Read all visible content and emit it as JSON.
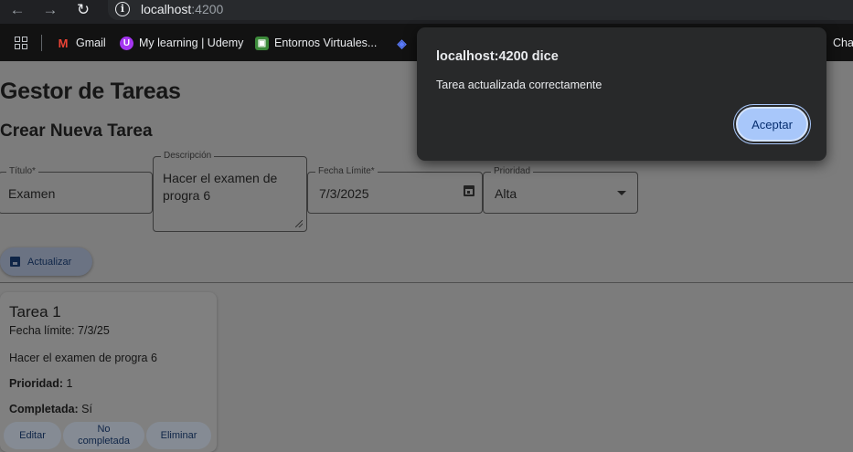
{
  "browser": {
    "url_host": "localhost",
    "url_port": ":4200",
    "bookmarks": [
      {
        "label": "Gmail",
        "icon": "gmail-icon"
      },
      {
        "label": "My learning | Udemy",
        "icon": "udemy-icon"
      },
      {
        "label": "Entornos Virtuales...",
        "icon": "course-icon"
      },
      {
        "label": "Cha",
        "icon": ""
      }
    ]
  },
  "page": {
    "title": "Gestor de Tareas",
    "form_title": "Crear Nueva Tarea",
    "fields": {
      "titulo": {
        "label": "Título*",
        "value": "Examen"
      },
      "descripcion": {
        "label": "Descripción",
        "value": "Hacer el examen de progra 6"
      },
      "fecha": {
        "label": "Fecha Límite*",
        "value": "7/3/2025"
      },
      "prioridad": {
        "label": "Prioridad",
        "value": "Alta"
      }
    },
    "update_button": "Actualizar"
  },
  "task_card": {
    "title": "Tarea 1",
    "fecha_limite": "Fecha límite: 7/3/25",
    "descripcion": "Hacer el examen de progra 6",
    "prioridad_label": "Prioridad:",
    "prioridad_value": " 1",
    "completada_label": "Completada:",
    "completada_value": " Sí",
    "buttons": {
      "edit": "Editar",
      "toggle": "No completada",
      "delete": "Eliminar"
    }
  },
  "dialog": {
    "title": "localhost:4200 dice",
    "message": "Tarea actualizada correctamente",
    "accept": "Aceptar",
    "accent": "#a8c7fa"
  }
}
